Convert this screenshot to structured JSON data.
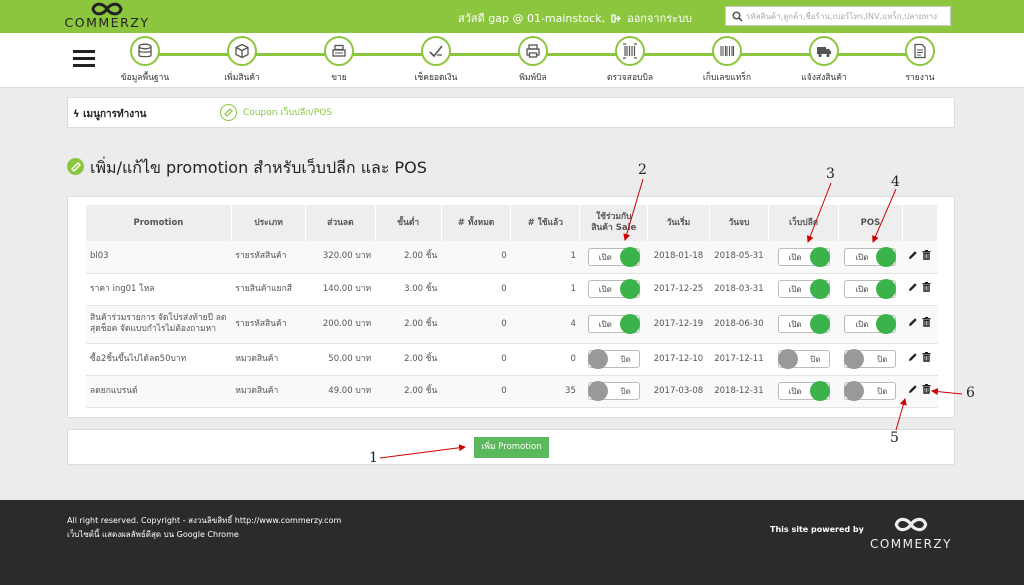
{
  "brand": {
    "name": "COMMERZY",
    "powered_by": "This site powered by"
  },
  "topbar": {
    "greeting": "สวัสดี gap @ 01-mainstock,",
    "logout": "ออกจากระบบ",
    "search_placeholder": "รหัสสินค้า,ลูกค้า,ชื่อร้าน,เบอร์โทร,INV,แทร็ก,ปลายทาง"
  },
  "nav": {
    "items": [
      {
        "label": "ข้อมูลพื้นฐาน",
        "icon": "database-icon"
      },
      {
        "label": "เพิ่มสินค้า",
        "icon": "box-icon"
      },
      {
        "label": "ขาย",
        "icon": "register-icon"
      },
      {
        "label": "เช็คยอดเงิน",
        "icon": "money-check-icon"
      },
      {
        "label": "พิมพ์บิล",
        "icon": "printer-icon"
      },
      {
        "label": "ตรวจสอบบิล",
        "icon": "barcode-scan-icon"
      },
      {
        "label": "เก็บเลขแทร็ก",
        "icon": "barcode-icon"
      },
      {
        "label": "แจ้งส่งสินค้า",
        "icon": "truck-icon"
      },
      {
        "label": "รายงาน",
        "icon": "report-icon"
      }
    ]
  },
  "breadcrumb": {
    "menu": "เมนูการทำงาน",
    "current": "Coupon เว็บปลีก/POS"
  },
  "page": {
    "title": "เพิ่ม/แก้ไข promotion สำหรับเว็บปลีก และ POS"
  },
  "table": {
    "headers": {
      "promotion": "Promotion",
      "type": "ประเภท",
      "discount": "ส่วนลด",
      "minimum": "ขั้นต่ำ",
      "total": "# ทั้งหมด",
      "used": "# ใช้แล้ว",
      "sale_line1": "ใช้ร่วมกับ",
      "sale_line2": "สินค้า Sale",
      "start": "วันเริ่ม",
      "end": "วันจบ",
      "web": "เว็บปลีก",
      "pos": "POS"
    },
    "toggle_on": "เปิด",
    "toggle_off": "ปิด",
    "rows": [
      {
        "name": "bl03",
        "type": "รายรหัสสินค้า",
        "discount": "320.00 บาท",
        "minimum": "2.00 ชิ้น",
        "total": "0",
        "used": "1",
        "sale": true,
        "start": "2018-01-18",
        "end": "2018-05-31",
        "web": true,
        "pos": true
      },
      {
        "name": "ราคา ing01 โหล",
        "type": "รายสินค้าแยกสี",
        "discount": "140.00 บาท",
        "minimum": "3.00 ชิ้น",
        "total": "0",
        "used": "1",
        "sale": true,
        "start": "2017-12-25",
        "end": "2018-03-31",
        "web": true,
        "pos": true
      },
      {
        "name": "สินค้าร่วมรายการ จัดโปรส่งท้ายปี ลดสุดช็อค จัดแบบกำไรไม่ต้องถามหา",
        "type": "รายรหัสสินค้า",
        "discount": "200.00 บาท",
        "minimum": "2.00 ชิ้น",
        "total": "0",
        "used": "4",
        "sale": true,
        "start": "2017-12-19",
        "end": "2018-06-30",
        "web": true,
        "pos": true
      },
      {
        "name": "ซื้อ2ชิ้นขึ้นไปได้ลด50บาท",
        "type": "หมวดสินค้า",
        "discount": "50.00 บาท",
        "minimum": "2.00 ชิ้น",
        "total": "0",
        "used": "0",
        "sale": false,
        "start": "2017-12-10",
        "end": "2017-12-11",
        "web": false,
        "pos": false
      },
      {
        "name": "ลดยกแบรนด์",
        "type": "หมวดสินค้า",
        "discount": "49.00 บาท",
        "minimum": "2.00 ชิ้น",
        "total": "0",
        "used": "35",
        "sale": false,
        "start": "2017-03-08",
        "end": "2018-12-31",
        "web": true,
        "pos": false
      }
    ]
  },
  "add_button": "เพิ่ม Promotion",
  "annotations": [
    "1",
    "2",
    "3",
    "4",
    "5",
    "6"
  ],
  "footer": {
    "copyright": "All right reserved. Copyright - สงวนลิขสิทธิ์ http://www.commerzy.com",
    "browser_note": "เว็บไซต์นี้ แสดงผลลัพธ์ดีสุด บน Google Chrome"
  },
  "colors": {
    "brand_green": "#8cc63f",
    "toggle_on": "#3cb34a",
    "toggle_off": "#999999",
    "footer_bg": "#2b2b2b"
  }
}
